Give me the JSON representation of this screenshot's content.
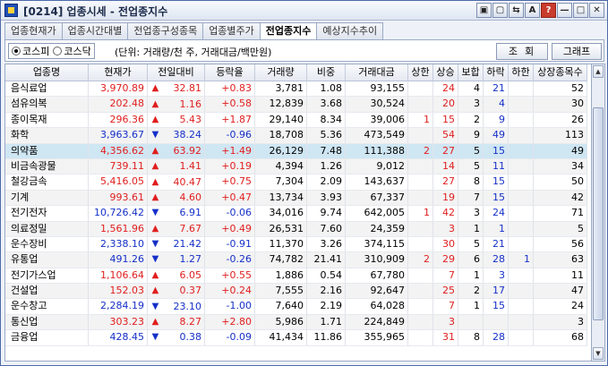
{
  "window": {
    "title": "[0214] 업종시세 - 전업종지수",
    "buttons": [
      "▣",
      "▢",
      "⇆",
      "A",
      "?",
      "—",
      "□",
      "✕"
    ]
  },
  "tabs": [
    {
      "label": "업종현재가",
      "active": false
    },
    {
      "label": "업종시간대별",
      "active": false
    },
    {
      "label": "전업종구성종목",
      "active": false
    },
    {
      "label": "업종별주가",
      "active": false
    },
    {
      "label": "전업종지수",
      "active": true
    },
    {
      "label": "예상지수추이",
      "active": false
    }
  ],
  "toolbar": {
    "radios": [
      {
        "label": "코스피",
        "checked": true
      },
      {
        "label": "코스닥",
        "checked": false
      }
    ],
    "unit_text": "(단위: 거래량/천 주, 거래대금/백만원)",
    "query_label": "조회",
    "graph_label": "그래프"
  },
  "grid": {
    "columns": [
      "업종명",
      "현재가",
      "전일대비",
      "등락율",
      "거래량",
      "비중",
      "거래대금",
      "상한",
      "상승",
      "보합",
      "하락",
      "하한",
      "상장종목수"
    ],
    "rows": [
      {
        "name": "음식료업",
        "price": "3,970.89",
        "dir": "up",
        "change": "32.81",
        "rate": "+0.83",
        "volume": "3,781",
        "weight": "1.08",
        "value": "93,155",
        "upper": "",
        "rise": "24",
        "flat": "4",
        "fall": "21",
        "lower": "",
        "listed": "52"
      },
      {
        "name": "섬유의복",
        "price": "202.48",
        "dir": "up",
        "change": "1.16",
        "rate": "+0.58",
        "volume": "12,839",
        "weight": "3.68",
        "value": "30,524",
        "upper": "",
        "rise": "20",
        "flat": "3",
        "fall": "4",
        "lower": "",
        "listed": "30"
      },
      {
        "name": "종이목재",
        "price": "296.36",
        "dir": "up",
        "change": "5.43",
        "rate": "+1.87",
        "volume": "29,140",
        "weight": "8.34",
        "value": "39,006",
        "upper": "1",
        "rise": "15",
        "flat": "2",
        "fall": "9",
        "lower": "",
        "listed": "26"
      },
      {
        "name": "화학",
        "price": "3,963.67",
        "dir": "down",
        "change": "38.24",
        "rate": "-0.96",
        "volume": "18,708",
        "weight": "5.36",
        "value": "473,549",
        "upper": "",
        "rise": "54",
        "flat": "9",
        "fall": "49",
        "lower": "",
        "listed": "113"
      },
      {
        "name": "의약품",
        "price": "4,356.62",
        "dir": "up",
        "change": "63.92",
        "rate": "+1.49",
        "volume": "26,129",
        "weight": "7.48",
        "value": "111,388",
        "upper": "2",
        "rise": "27",
        "flat": "5",
        "fall": "15",
        "lower": "",
        "listed": "49",
        "selected": true
      },
      {
        "name": "비금속광물",
        "price": "739.11",
        "dir": "up",
        "change": "1.41",
        "rate": "+0.19",
        "volume": "4,394",
        "weight": "1.26",
        "value": "9,012",
        "upper": "",
        "rise": "14",
        "flat": "5",
        "fall": "11",
        "lower": "",
        "listed": "34"
      },
      {
        "name": "철강금속",
        "price": "5,416.05",
        "dir": "up",
        "change": "40.47",
        "rate": "+0.75",
        "volume": "7,304",
        "weight": "2.09",
        "value": "143,637",
        "upper": "",
        "rise": "27",
        "flat": "8",
        "fall": "15",
        "lower": "",
        "listed": "50"
      },
      {
        "name": "기계",
        "price": "993.61",
        "dir": "up",
        "change": "4.60",
        "rate": "+0.47",
        "volume": "13,734",
        "weight": "3.93",
        "value": "67,337",
        "upper": "",
        "rise": "19",
        "flat": "7",
        "fall": "15",
        "lower": "",
        "listed": "42"
      },
      {
        "name": "전기전자",
        "price": "10,726.42",
        "dir": "down",
        "change": "6.91",
        "rate": "-0.06",
        "volume": "34,016",
        "weight": "9.74",
        "value": "642,005",
        "upper": "1",
        "rise": "42",
        "flat": "3",
        "fall": "24",
        "lower": "",
        "listed": "71"
      },
      {
        "name": "의료정밀",
        "price": "1,561.96",
        "dir": "up",
        "change": "7.67",
        "rate": "+0.49",
        "volume": "26,531",
        "weight": "7.60",
        "value": "24,359",
        "upper": "",
        "rise": "3",
        "flat": "1",
        "fall": "1",
        "lower": "",
        "listed": "5"
      },
      {
        "name": "운수장비",
        "price": "2,338.10",
        "dir": "down",
        "change": "21.42",
        "rate": "-0.91",
        "volume": "11,370",
        "weight": "3.26",
        "value": "374,115",
        "upper": "",
        "rise": "30",
        "flat": "5",
        "fall": "21",
        "lower": "",
        "listed": "56"
      },
      {
        "name": "유통업",
        "price": "491.26",
        "dir": "down",
        "change": "1.27",
        "rate": "-0.26",
        "volume": "74,782",
        "weight": "21.41",
        "value": "310,909",
        "upper": "2",
        "rise": "29",
        "flat": "6",
        "fall": "28",
        "lower": "1",
        "listed": "63"
      },
      {
        "name": "전기가스업",
        "price": "1,106.64",
        "dir": "up",
        "change": "6.05",
        "rate": "+0.55",
        "volume": "1,886",
        "weight": "0.54",
        "value": "67,780",
        "upper": "",
        "rise": "7",
        "flat": "1",
        "fall": "3",
        "lower": "",
        "listed": "11"
      },
      {
        "name": "건설업",
        "price": "152.03",
        "dir": "up",
        "change": "0.37",
        "rate": "+0.24",
        "volume": "7,555",
        "weight": "2.16",
        "value": "92,647",
        "upper": "",
        "rise": "25",
        "flat": "2",
        "fall": "17",
        "lower": "",
        "listed": "47"
      },
      {
        "name": "운수창고",
        "price": "2,284.19",
        "dir": "down",
        "change": "23.10",
        "rate": "-1.00",
        "volume": "7,640",
        "weight": "2.19",
        "value": "64,028",
        "upper": "",
        "rise": "7",
        "flat": "1",
        "fall": "15",
        "lower": "",
        "listed": "24"
      },
      {
        "name": "통신업",
        "price": "303.23",
        "dir": "up",
        "change": "8.27",
        "rate": "+2.80",
        "volume": "5,986",
        "weight": "1.71",
        "value": "224,849",
        "upper": "",
        "rise": "3",
        "flat": "",
        "fall": "",
        "lower": "",
        "listed": "3"
      },
      {
        "name": "금융업",
        "price": "428.45",
        "dir": "down",
        "change": "0.38",
        "rate": "-0.09",
        "volume": "41,434",
        "weight": "11.86",
        "value": "355,965",
        "upper": "",
        "rise": "31",
        "flat": "8",
        "fall": "28",
        "lower": "",
        "listed": "68"
      }
    ]
  },
  "icons": {
    "up": "▲",
    "down": "▼",
    "scroll_up": "▲",
    "scroll_down": "▼"
  },
  "colors": {
    "up": "#e01e1e",
    "down": "#1530c8",
    "selected_row": "#cfe6f3"
  }
}
